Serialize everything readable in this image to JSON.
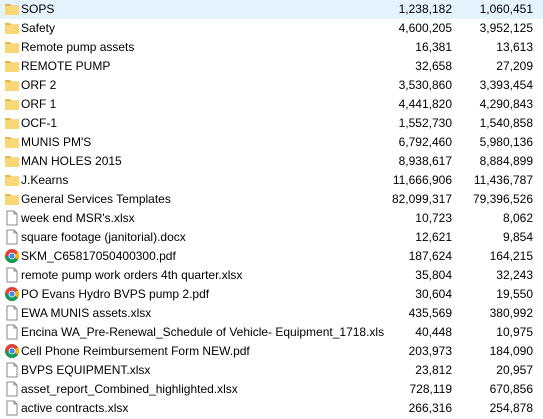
{
  "colors": {
    "folder": "#f8d775",
    "folder_tab": "#e6b84b",
    "chrome_red": "#db4437",
    "chrome_green": "#0f9d58",
    "chrome_yellow": "#f4b400",
    "chrome_blue": "#4285f4"
  },
  "files": [
    {
      "name": "SOPS",
      "size": "1,238,182",
      "packed": "1,060,451",
      "icon": "folder-icon"
    },
    {
      "name": "Safety",
      "size": "4,600,205",
      "packed": "3,952,125",
      "icon": "folder-icon"
    },
    {
      "name": "Remote pump assets",
      "size": "16,381",
      "packed": "13,613",
      "icon": "folder-icon"
    },
    {
      "name": "REMOTE PUMP",
      "size": "32,658",
      "packed": "27,209",
      "icon": "folder-icon"
    },
    {
      "name": "ORF 2",
      "size": "3,530,860",
      "packed": "3,393,454",
      "icon": "folder-icon"
    },
    {
      "name": "ORF 1",
      "size": "4,441,820",
      "packed": "4,290,843",
      "icon": "folder-icon"
    },
    {
      "name": "OCF-1",
      "size": "1,552,730",
      "packed": "1,540,858",
      "icon": "folder-icon"
    },
    {
      "name": "MUNIS PM'S",
      "size": "6,792,460",
      "packed": "5,980,136",
      "icon": "folder-icon"
    },
    {
      "name": "MAN HOLES 2015",
      "size": "8,938,617",
      "packed": "8,884,899",
      "icon": "folder-icon"
    },
    {
      "name": "J.Kearns",
      "size": "11,666,906",
      "packed": "11,436,787",
      "icon": "folder-icon"
    },
    {
      "name": "General Services Templates",
      "size": "82,099,317",
      "packed": "79,396,526",
      "icon": "folder-icon"
    },
    {
      "name": "week end MSR's.xlsx",
      "size": "10,723",
      "packed": "8,062",
      "icon": "file-icon"
    },
    {
      "name": "square footage (janitorial).docx",
      "size": "12,621",
      "packed": "9,854",
      "icon": "file-icon"
    },
    {
      "name": "SKM_C65817050400300.pdf",
      "size": "187,624",
      "packed": "164,215",
      "icon": "chrome-icon"
    },
    {
      "name": "remote pump work orders 4th quarter.xlsx",
      "size": "35,804",
      "packed": "32,243",
      "icon": "file-icon"
    },
    {
      "name": "PO Evans Hydro BVPS pump 2.pdf",
      "size": "30,604",
      "packed": "19,550",
      "icon": "chrome-icon"
    },
    {
      "name": "EWA MUNIS assets.xlsx",
      "size": "435,569",
      "packed": "380,992",
      "icon": "file-icon"
    },
    {
      "name": "Encina WA_Pre-Renewal_Schedule of Vehicle- Equipment_1718.xls",
      "size": "40,448",
      "packed": "10,975",
      "icon": "file-icon"
    },
    {
      "name": "Cell Phone Reimbursement Form NEW.pdf",
      "size": "203,973",
      "packed": "184,090",
      "icon": "chrome-icon"
    },
    {
      "name": "BVPS EQUIPMENT.xlsx",
      "size": "23,812",
      "packed": "20,957",
      "icon": "file-icon"
    },
    {
      "name": "asset_report_Combined_highlighted.xlsx",
      "size": "728,119",
      "packed": "670,856",
      "icon": "file-icon"
    },
    {
      "name": "active contracts.xlsx",
      "size": "266,316",
      "packed": "254,878",
      "icon": "file-icon"
    }
  ]
}
